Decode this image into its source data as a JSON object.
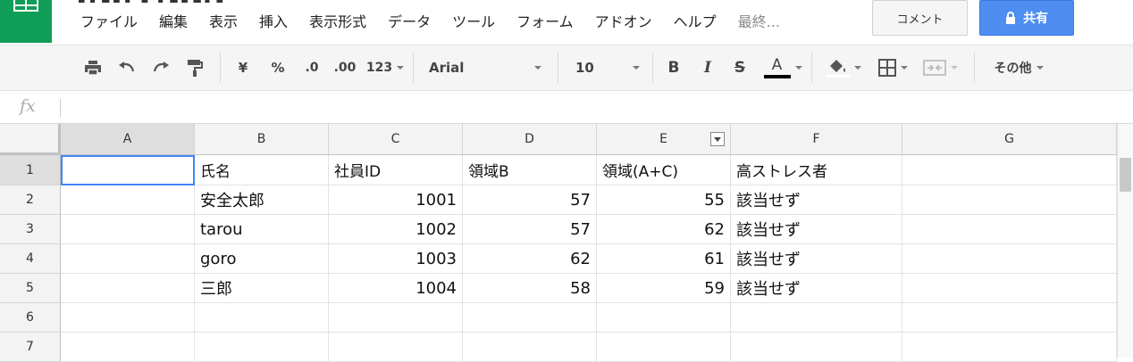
{
  "header": {
    "menu": [
      "ファイル",
      "編集",
      "表示",
      "挿入",
      "表示形式",
      "データ",
      "ツール",
      "フォーム",
      "アドオン",
      "ヘルプ"
    ],
    "last_edit": "最終...",
    "comment_label": "コメント",
    "share_label": "共有"
  },
  "toolbar": {
    "currency": "¥",
    "percent": "%",
    "dec_less": ".0",
    "dec_more": ".00",
    "number_format": "123",
    "font": "Arial",
    "font_size": "10",
    "bold": "B",
    "italic": "I",
    "strike": "S",
    "text_color_letter": "A",
    "more_label": "その他"
  },
  "formula": {
    "fx_label": "fx",
    "value": ""
  },
  "grid": {
    "columns": [
      "A",
      "B",
      "C",
      "D",
      "E",
      "F",
      "G"
    ],
    "row_numbers": [
      "1",
      "2",
      "3",
      "4",
      "5",
      "6",
      "7"
    ],
    "rows": [
      [
        "",
        "氏名",
        "社員ID",
        "領域B",
        "領域(A+C)",
        "高ストレス者",
        ""
      ],
      [
        "",
        "安全太郎",
        "1001",
        "57",
        "55",
        "該当せず",
        ""
      ],
      [
        "",
        "tarou",
        "1002",
        "57",
        "62",
        "該当せず",
        ""
      ],
      [
        "",
        "goro",
        "1003",
        "62",
        "61",
        "該当せず",
        ""
      ],
      [
        "",
        "三郎",
        "1004",
        "58",
        "59",
        "該当せず",
        ""
      ],
      [
        "",
        "",
        "",
        "",
        "",
        "",
        ""
      ],
      [
        "",
        "",
        "",
        "",
        "",
        "",
        ""
      ]
    ]
  },
  "colors": {
    "sheets_green": "#0f9d58",
    "share_blue": "#4d8ef0",
    "selection_blue": "#4285f4"
  }
}
